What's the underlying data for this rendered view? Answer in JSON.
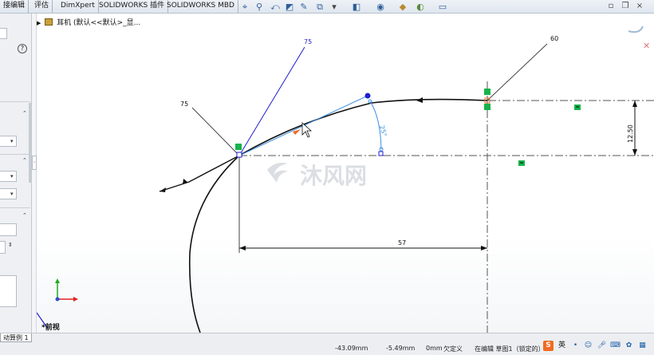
{
  "tabs": [
    "接编辑",
    "评估",
    "DimXpert",
    "SOLIDWORKS 插件",
    "SOLIDWORKS MBD"
  ],
  "feature_tree": {
    "root_label": "耳机  (默认<<默认>_显..."
  },
  "left_panel": {
    "help_glyph": "?"
  },
  "dimensions": {
    "d75_blue": "75",
    "d75_leader": "75",
    "d60": "60",
    "d25": "25°",
    "d57": "57",
    "d1250": "12.50"
  },
  "watermark": {
    "text": "沐风网"
  },
  "view_label": "*前视",
  "model_tab": "动算例 1",
  "status": {
    "x": "-43.09mm",
    "y": "-5.49mm",
    "z": "0mm",
    "define": "欠定义",
    "mode": "在编辑 草图1（锁定的）"
  },
  "ime": {
    "lang": "英"
  },
  "colors": {
    "sketch_blue": "#1f1fd0",
    "light_blue": "#3b8fe0",
    "relation_green": "#16b34a",
    "accent_orange": "#f26a21"
  },
  "icons": [
    "zoom-fit-icon",
    "zoom-area-icon",
    "previous-view-icon",
    "section-view-icon",
    "dynamic-annotation-icon",
    "view-orientation-icon",
    "display-style-icon",
    "hide-show-icon",
    "edit-appearance-icon",
    "scene-icon",
    "view-settings-icon"
  ]
}
